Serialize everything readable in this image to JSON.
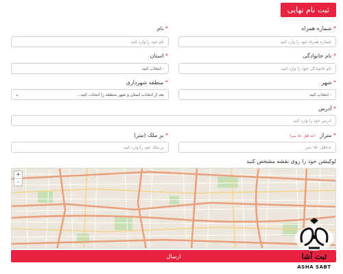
{
  "header": {
    "title": "ثبت نام نهایی"
  },
  "form": {
    "mobile": {
      "label": "شماره همراه",
      "placeholder": "شماره همراه خود را وارد کنید"
    },
    "first_name": {
      "label": "نام",
      "placeholder": "نام خود را وارد کنید"
    },
    "last_name": {
      "label": "نام خانوادگی",
      "placeholder": "نام خانوادگی خود را وارد کنید"
    },
    "province": {
      "label": "استان",
      "selected": "- انتخاب کنید"
    },
    "city": {
      "label": "شهر",
      "selected": "- انتخاب کنید"
    },
    "district": {
      "label": "منطقه شهرداری",
      "selected": "بعد از انتخاب استان و شهر منطقه را انتخاب کنید..."
    },
    "address": {
      "label": "آدرس",
      "placeholder": "آدرس خود را وارد کنید"
    },
    "area": {
      "label": "متراژ",
      "note": "(حد اقل ۱۵۰ متر)",
      "placeholder": "حداقل ۱۵۰ متر"
    },
    "lot": {
      "label": "بر ملک (متر)",
      "placeholder": "بر ملک خود را وارد کنید"
    },
    "map_instruction": "لوکیشن خود را روی نقشه مشخص کنید",
    "required_mark": "*",
    "submit_label": "ارسال"
  },
  "map": {
    "zoom_in": "+",
    "zoom_out": "-"
  },
  "brand": {
    "name_fa": "ثبت آشا",
    "name_en": "ASHA SABT",
    "accent": "#e8233f"
  }
}
